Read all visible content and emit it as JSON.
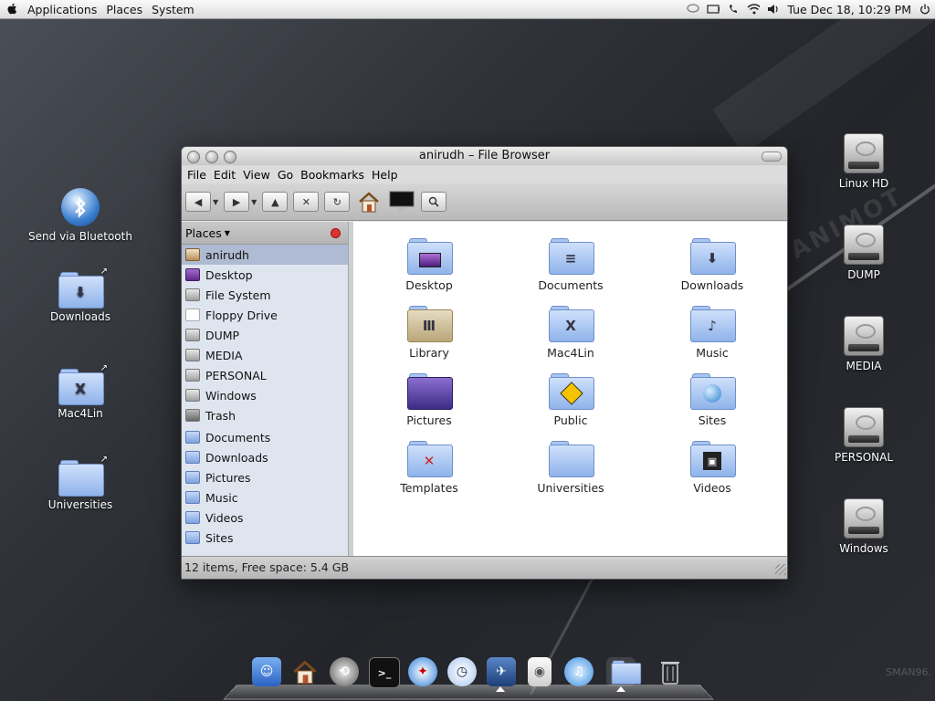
{
  "top_panel": {
    "menus": [
      "Applications",
      "Places",
      "System"
    ],
    "clock": "Tue Dec 18, 10:29 PM"
  },
  "desktop_left": [
    {
      "label": "Send via Bluetooth",
      "icon": "bluetooth-icon"
    },
    {
      "label": "Downloads",
      "icon": "downloads-folder-icon"
    },
    {
      "label": "Mac4Lin",
      "icon": "mac4lin-folder-icon"
    },
    {
      "label": "Universities",
      "icon": "folder-icon"
    }
  ],
  "desktop_right": [
    {
      "label": "Linux HD",
      "icon": "hard-drive-icon"
    },
    {
      "label": "DUMP",
      "icon": "hard-drive-icon"
    },
    {
      "label": "MEDIA",
      "icon": "hard-drive-icon"
    },
    {
      "label": "PERSONAL",
      "icon": "hard-drive-icon"
    },
    {
      "label": "Windows",
      "icon": "hard-drive-icon"
    }
  ],
  "window": {
    "title": "anirudh – File Browser",
    "menus": [
      "File",
      "Edit",
      "View",
      "Go",
      "Bookmarks",
      "Help"
    ],
    "sidebar_header": "Places",
    "sidebar_items": [
      {
        "label": "anirudh",
        "icon": "home-icon",
        "active": true
      },
      {
        "label": "Desktop",
        "icon": "desktop-icon"
      },
      {
        "label": "File System",
        "icon": "drive-icon"
      },
      {
        "label": "Floppy Drive",
        "icon": "floppy-icon"
      },
      {
        "label": "DUMP",
        "icon": "drive-icon"
      },
      {
        "label": "MEDIA",
        "icon": "drive-icon"
      },
      {
        "label": "PERSONAL",
        "icon": "drive-icon"
      },
      {
        "label": "Windows",
        "icon": "drive-icon"
      },
      {
        "label": "Trash",
        "icon": "trash-icon"
      },
      {
        "label": "Documents",
        "icon": "folder-icon"
      },
      {
        "label": "Downloads",
        "icon": "folder-icon"
      },
      {
        "label": "Pictures",
        "icon": "folder-icon"
      },
      {
        "label": "Music",
        "icon": "folder-icon"
      },
      {
        "label": "Videos",
        "icon": "folder-icon"
      },
      {
        "label": "Sites",
        "icon": "folder-icon"
      }
    ],
    "folders": [
      {
        "label": "Desktop",
        "icon": "desktop-folder-icon"
      },
      {
        "label": "Documents",
        "icon": "documents-folder-icon"
      },
      {
        "label": "Downloads",
        "icon": "downloads-folder-icon"
      },
      {
        "label": "Library",
        "icon": "library-folder-icon"
      },
      {
        "label": "Mac4Lin",
        "icon": "mac4lin-folder-icon"
      },
      {
        "label": "Music",
        "icon": "music-folder-icon"
      },
      {
        "label": "Pictures",
        "icon": "pictures-folder-icon"
      },
      {
        "label": "Public",
        "icon": "public-folder-icon"
      },
      {
        "label": "Sites",
        "icon": "sites-folder-icon"
      },
      {
        "label": "Templates",
        "icon": "templates-folder-icon"
      },
      {
        "label": "Universities",
        "icon": "folder-icon"
      },
      {
        "label": "Videos",
        "icon": "videos-folder-icon"
      }
    ],
    "status": "12 items, Free space: 5.4 GB"
  },
  "dock": [
    "finder",
    "home",
    "time-machine",
    "terminal",
    "safari",
    "clock",
    "preview",
    "ipod",
    "itunes",
    "folder",
    "trash"
  ],
  "watermark": "SMAN96.",
  "colors": {
    "accent": "#aebbd2",
    "folder": "#8fb3ea",
    "panel": "#dcdcdc"
  }
}
